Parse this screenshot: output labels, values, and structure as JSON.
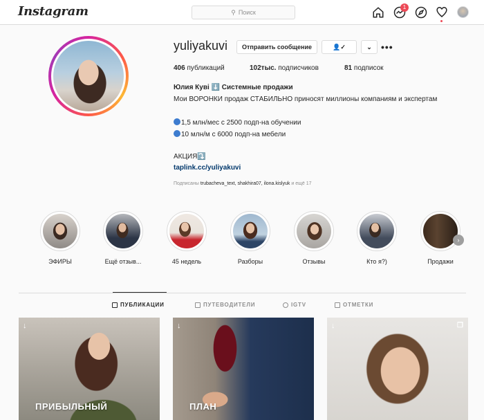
{
  "nav": {
    "logo": "Instagram",
    "search_placeholder": "Поиск",
    "messenger_badge": "1",
    "icons": [
      "home-icon",
      "messenger-icon",
      "explore-icon",
      "activity-heart-icon",
      "profile-avatar"
    ]
  },
  "profile": {
    "username": "yuliyakuvi",
    "message_button": "Отправить сообщение",
    "following_button_icon": "person-check-icon",
    "dropdown_icon": "chevron-down-icon",
    "more_label": "•••",
    "stats": [
      {
        "value": "406",
        "label": "публикаций"
      },
      {
        "value": "102тыс.",
        "label": "подписчиков"
      },
      {
        "value": "81",
        "label": "подписок"
      }
    ],
    "full_name": "Юлия Кувi ⬇️ Системные продажи",
    "bio_1": "Мои ВОРОНКИ продаж СТАБИЛЬНО приносят миллионы компаниям и экспертам",
    "bio_2": "1,5 млн/мес с 2500 подп-на обучении",
    "bio_3": "10 млн/м с 6000 подп-на мебели",
    "bio_4": "АКЦИЯ⤵️",
    "link": "taplink.cc/yuliyakuvi",
    "followed_prefix": "Подписаны",
    "followed_by": "trubacheva_text, shakhira07, ilona.kislyuk",
    "followed_suffix": "и ещё 17"
  },
  "highlights": [
    {
      "label": "ЭФИРЫ"
    },
    {
      "label": "Ещё отзыв..."
    },
    {
      "label": "45 недель"
    },
    {
      "label": "Разборы"
    },
    {
      "label": "Отзывы"
    },
    {
      "label": "Кто я?)"
    },
    {
      "label": "Продажи"
    }
  ],
  "tabs": [
    {
      "label": "ПУБЛИКАЦИИ",
      "active": true
    },
    {
      "label": "ПУТЕВОДИТЕЛИ",
      "active": false
    },
    {
      "label": "IGTV",
      "active": false
    },
    {
      "label": "ОТМЕТКИ",
      "active": false
    }
  ],
  "posts": [
    {
      "caption": "ПРИБЫЛЬНЫЙ"
    },
    {
      "caption": "ПЛАН"
    },
    {
      "caption": ""
    }
  ]
}
